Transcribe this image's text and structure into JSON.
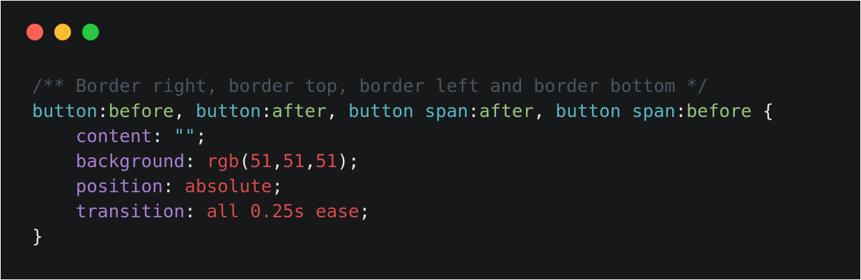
{
  "window": {
    "controls": [
      {
        "name": "close-button",
        "color": "#ff5f57"
      },
      {
        "name": "minimize-button",
        "color": "#febc2e"
      },
      {
        "name": "zoom-button",
        "color": "#28c840"
      }
    ]
  },
  "colors": {
    "comment": "#4a5560",
    "selector": "#56b6c2",
    "pseudo": "#98c379",
    "punct": "#e6e6e6",
    "property": "#a77fd1",
    "string": "#56b6c2",
    "value": "#d74a4a"
  },
  "code": {
    "lines": [
      [
        {
          "t": "/** Border right, border top, border left and border bottom */",
          "c": "comment"
        }
      ],
      [
        {
          "t": "button",
          "c": "selector"
        },
        {
          "t": ":",
          "c": "punct"
        },
        {
          "t": "before",
          "c": "pseudo"
        },
        {
          "t": ", ",
          "c": "punct"
        },
        {
          "t": "button",
          "c": "selector"
        },
        {
          "t": ":",
          "c": "punct"
        },
        {
          "t": "after",
          "c": "pseudo"
        },
        {
          "t": ", ",
          "c": "punct"
        },
        {
          "t": "button span",
          "c": "selector"
        },
        {
          "t": ":",
          "c": "punct"
        },
        {
          "t": "after",
          "c": "pseudo"
        },
        {
          "t": ", ",
          "c": "punct"
        },
        {
          "t": "button span",
          "c": "selector"
        },
        {
          "t": ":",
          "c": "punct"
        },
        {
          "t": "before",
          "c": "pseudo"
        },
        {
          "t": " {",
          "c": "punct"
        }
      ],
      [
        {
          "t": "    ",
          "c": "punct"
        },
        {
          "t": "content",
          "c": "property"
        },
        {
          "t": ": ",
          "c": "punct"
        },
        {
          "t": "\"\"",
          "c": "string"
        },
        {
          "t": ";",
          "c": "punct"
        }
      ],
      [
        {
          "t": "    ",
          "c": "punct"
        },
        {
          "t": "background",
          "c": "property"
        },
        {
          "t": ": ",
          "c": "punct"
        },
        {
          "t": "rgb",
          "c": "value"
        },
        {
          "t": "(",
          "c": "punct"
        },
        {
          "t": "51",
          "c": "value"
        },
        {
          "t": ",",
          "c": "punct"
        },
        {
          "t": "51",
          "c": "value"
        },
        {
          "t": ",",
          "c": "punct"
        },
        {
          "t": "51",
          "c": "value"
        },
        {
          "t": ");",
          "c": "punct"
        }
      ],
      [
        {
          "t": "    ",
          "c": "punct"
        },
        {
          "t": "position",
          "c": "property"
        },
        {
          "t": ": ",
          "c": "punct"
        },
        {
          "t": "absolute",
          "c": "value"
        },
        {
          "t": ";",
          "c": "punct"
        }
      ],
      [
        {
          "t": "    ",
          "c": "punct"
        },
        {
          "t": "transition",
          "c": "property"
        },
        {
          "t": ": ",
          "c": "punct"
        },
        {
          "t": "all 0.25s ease",
          "c": "value"
        },
        {
          "t": ";",
          "c": "punct"
        }
      ],
      [
        {
          "t": "}",
          "c": "punct"
        }
      ]
    ]
  }
}
